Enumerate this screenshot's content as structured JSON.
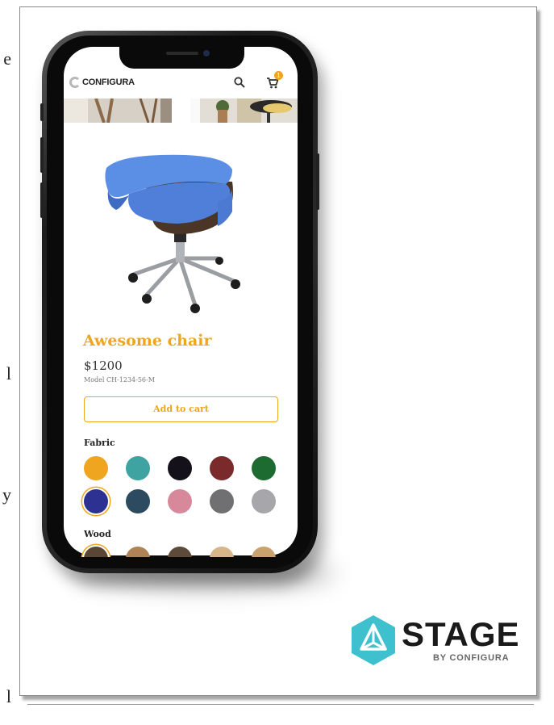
{
  "page_edge": [
    "e",
    "l",
    "y",
    "l"
  ],
  "app": {
    "brand": "CONFIGURA",
    "cart_count": "1"
  },
  "product": {
    "title": "Awesome chair",
    "price": "$1200",
    "model": "Model CH-1234-56-M",
    "add_to_cart": "Add to cart"
  },
  "options": {
    "fabric_label": "Fabric",
    "wood_label": "Wood",
    "fabric_colors": [
      "#f0a520",
      "#3fa3a2",
      "#14111a",
      "#7a2a2a",
      "#1e6b32",
      "#2c3192",
      "#2c4a60",
      "#d7899b",
      "#707073",
      "#a6a6ab"
    ],
    "wood_colors": [
      "#5a4634",
      "#b08357",
      "#5d4a38",
      "#d9b58a",
      "#c9a26e"
    ],
    "selected_fabric_index": 5,
    "selected_wood_index": 0
  },
  "branding": {
    "stage_title": "STAGE",
    "stage_sub": "BY CONFIGURA",
    "accent": "#f0a520",
    "stage_color": "#3fc0cf"
  },
  "icons": [
    "search-icon",
    "cart-icon",
    "configura-logo-icon",
    "stage-logo-icon"
  ]
}
